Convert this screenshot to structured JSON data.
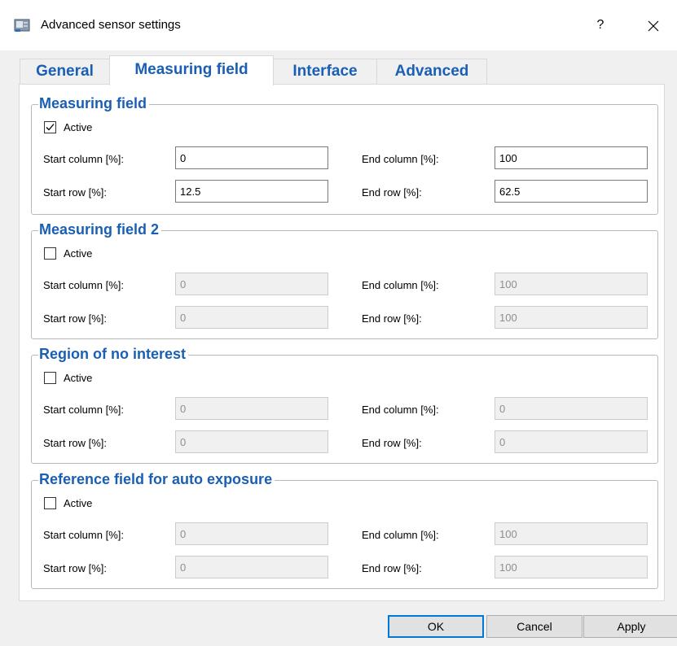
{
  "window": {
    "title": "Advanced sensor settings",
    "help": "?",
    "close": "✕"
  },
  "tabs": [
    {
      "label": "General",
      "active": false
    },
    {
      "label": "Measuring field",
      "active": true
    },
    {
      "label": "Interface",
      "active": false
    },
    {
      "label": "Advanced",
      "active": false
    }
  ],
  "labels": {
    "active": "Active",
    "start_column": "Start column [%]:",
    "end_column": "End column [%]:",
    "start_row": "Start row [%]:",
    "end_row": "End row [%]:"
  },
  "groups": [
    {
      "title": "Measuring field",
      "active": true,
      "enabled": true,
      "start_column": "0",
      "end_column": "100",
      "start_row": "12.5",
      "end_row": "62.5"
    },
    {
      "title": "Measuring field 2",
      "active": false,
      "enabled": false,
      "start_column": "0",
      "end_column": "100",
      "start_row": "0",
      "end_row": "100"
    },
    {
      "title": "Region of no interest",
      "active": false,
      "enabled": false,
      "start_column": "0",
      "end_column": "0",
      "start_row": "0",
      "end_row": "0"
    },
    {
      "title": "Reference field for auto exposure",
      "active": false,
      "enabled": false,
      "start_column": "0",
      "end_column": "100",
      "start_row": "0",
      "end_row": "100"
    }
  ],
  "buttons": {
    "ok": "OK",
    "cancel": "Cancel",
    "apply": "Apply"
  },
  "colors": {
    "accent": "#1a5fb4",
    "default_button_border": "#0078d7"
  }
}
